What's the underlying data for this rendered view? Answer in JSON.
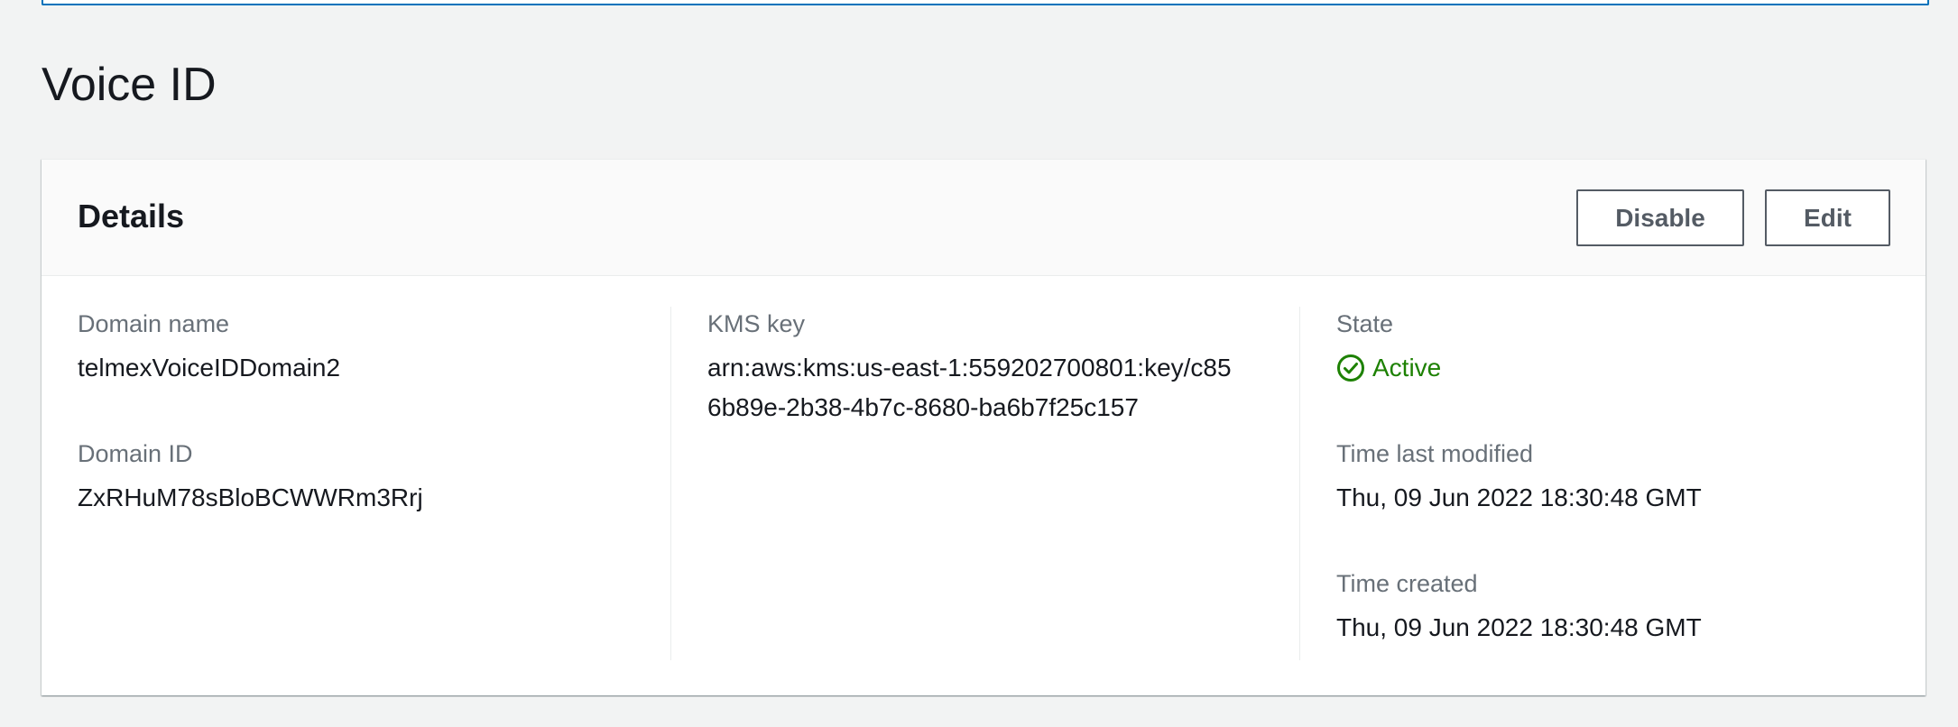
{
  "page": {
    "title": "Voice ID"
  },
  "details": {
    "title": "Details",
    "disable_label": "Disable",
    "edit_label": "Edit",
    "domain_name_label": "Domain name",
    "domain_name_value": "telmexVoiceIDDomain2",
    "domain_id_label": "Domain ID",
    "domain_id_value": "ZxRHuM78sBloBCWWRm3Rrj",
    "kms_key_label": "KMS key",
    "kms_key_value": "arn:aws:kms:us-east-1:559202700801:key/c856b89e-2b38-4b7c-8680-ba6b7f25c157",
    "state_label": "State",
    "state_value": "Active",
    "state_icon": "status-success-icon",
    "time_last_modified_label": "Time last modified",
    "time_last_modified_value": "Thu, 09 Jun 2022 18:30:48 GMT",
    "time_created_label": "Time created",
    "time_created_value": "Thu, 09 Jun 2022 18:30:48 GMT"
  },
  "colors": {
    "accent": "#0073bb",
    "success": "#1d8102",
    "label": "#687078",
    "text": "#16191f"
  }
}
